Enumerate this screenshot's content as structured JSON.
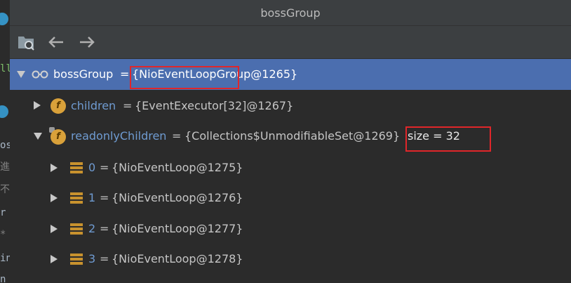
{
  "window": {
    "title": "bossGroup"
  },
  "toolbar": {
    "buttons": [
      {
        "name": "new-watch-button",
        "icon": "folder-search-icon"
      },
      {
        "name": "back-button",
        "icon": "arrow-left-icon"
      },
      {
        "name": "forward-button",
        "icon": "arrow-right-icon"
      }
    ]
  },
  "left_gutter": {
    "fragments": [
      "ll",
      "os",
      "進",
      "不.",
      "r",
      "*",
      "in",
      "n"
    ]
  },
  "tree": {
    "root": {
      "name": "bossGroup",
      "eq": "=",
      "value": "{NioEventLoopGroup@1265}",
      "icon": "watch-glasses-icon",
      "expanded": true,
      "selected": true
    },
    "children_field": {
      "name": "children",
      "eq": "=",
      "value": "{EventExecutor[32]@1267}",
      "icon": "field-f-icon",
      "expanded": false
    },
    "readonly_field": {
      "name": "readonlyChildren",
      "eq": "=",
      "value": "{Collections$UnmodifiableSet@1269}",
      "size_label": "size = 32",
      "icon": "field-f-icon",
      "expanded": true
    },
    "items": [
      {
        "index": "0",
        "eq": "=",
        "value": "{NioEventLoop@1275}"
      },
      {
        "index": "1",
        "eq": "=",
        "value": "{NioEventLoop@1276}"
      },
      {
        "index": "2",
        "eq": "=",
        "value": "{NioEventLoop@1277}"
      },
      {
        "index": "3",
        "eq": "=",
        "value": "{NioEventLoop@1278}"
      }
    ]
  },
  "colors": {
    "selection": "#4b6eaf",
    "highlight_box": "#e0262a",
    "field_name": "#6f9bd1",
    "field_icon": "#d9a13a"
  }
}
